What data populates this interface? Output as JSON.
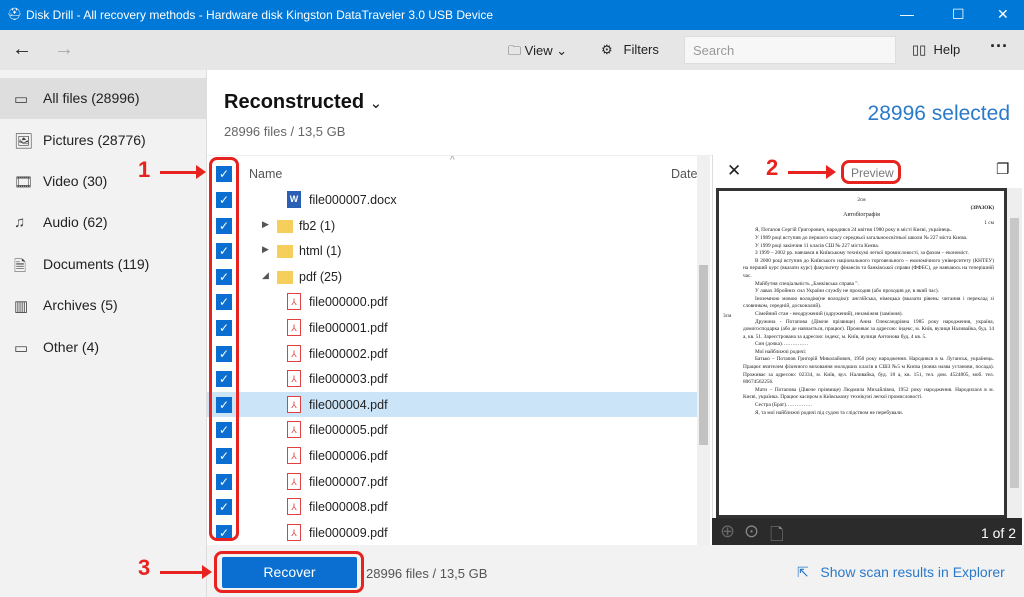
{
  "window": {
    "title": "Disk Drill - All recovery methods - Hardware disk Kingston DataTraveler 3.0 USB Device"
  },
  "toolbar": {
    "view": "View",
    "filters": "Filters",
    "search_placeholder": "Search",
    "help": "Help"
  },
  "sidebar": {
    "items": [
      {
        "label": "All files (28996)",
        "icon": "all-files-icon",
        "selected": true
      },
      {
        "label": "Pictures (28776)",
        "icon": "picture-icon"
      },
      {
        "label": "Video (30)",
        "icon": "video-icon"
      },
      {
        "label": "Audio (62)",
        "icon": "audio-icon"
      },
      {
        "label": "Documents (119)",
        "icon": "document-icon"
      },
      {
        "label": "Archives (5)",
        "icon": "archive-icon"
      },
      {
        "label": "Other (4)",
        "icon": "other-icon"
      }
    ]
  },
  "main": {
    "title": "Reconstructed",
    "subtitle": "28996 files / 13,5 GB",
    "selected": "28996 selected",
    "columns": {
      "name": "Name",
      "date": "Date"
    },
    "rows": [
      {
        "name": "file000007.docx",
        "type": "docx",
        "level": 2
      },
      {
        "name": "fb2 (1)",
        "type": "folder",
        "expanded": false,
        "level": 1
      },
      {
        "name": "html (1)",
        "type": "folder",
        "expanded": false,
        "level": 1
      },
      {
        "name": "pdf (25)",
        "type": "folder",
        "expanded": true,
        "level": 1
      },
      {
        "name": "file000000.pdf",
        "type": "pdf",
        "level": 2
      },
      {
        "name": "file000001.pdf",
        "type": "pdf",
        "level": 2
      },
      {
        "name": "file000002.pdf",
        "type": "pdf",
        "level": 2
      },
      {
        "name": "file000003.pdf",
        "type": "pdf",
        "level": 2
      },
      {
        "name": "file000004.pdf",
        "type": "pdf",
        "level": 2,
        "selected": true
      },
      {
        "name": "file000005.pdf",
        "type": "pdf",
        "level": 2
      },
      {
        "name": "file000006.pdf",
        "type": "pdf",
        "level": 2
      },
      {
        "name": "file000007.pdf",
        "type": "pdf",
        "level": 2
      },
      {
        "name": "file000008.pdf",
        "type": "pdf",
        "level": 2
      },
      {
        "name": "file000009.pdf",
        "type": "pdf",
        "level": 2
      }
    ]
  },
  "preview": {
    "label": "Preview",
    "page": "1 of 2",
    "doc": {
      "stamp": "(ЗРАЗОК)",
      "heading": "Автобіографія",
      "margin_left": "3см",
      "margin_top": "2см",
      "margin_right": "1 см",
      "lines": [
        "Я, Потапов Сергій Григорович, народився 24 квітня 1980 року в місті Києві, українець.",
        "У 1989 році вступив до першого класу середньої загальноосвітньої школи № 227 міста Києва.",
        "У 1999 році закінчив 11 класів СШ № 227 міста Києва.",
        "З 1999 – 2002 рр. навчався в Київському технікумі легкої промисловості, за фахом – економіст.",
        "В 2000 році вступив до Київського національного торговельного – економічного університету (КНТЕУ) на перший курс (вказати курс) факультету фінансів та банківської справи (ФФБС), де навчаюсь на теперішній час.",
        "Майбутня спеціальність „Банківська справа ”.",
        "У лавах Збройних сил України службу не проходив (або проходив де, в який час).",
        "Іноземною мовою володію(не володію): англійська, німецька (вказати рівень: читання і переклад зі словником, середній, досконалий).",
        "Сімейний стан - неодружений (одружений), незаміжня (заміжня).",
        "Дружина - Потапова (Дівоче прізвище) Анна Олександрівна 1985 року народження, україна, домогосподарка (або де навчається, працює). Проживає за адресою: індекс, м. Київ, вулиця Наливайка, буд. 14 а, кв. 51. Зареєстрована за адресою: індекс, м. Київ, вулиця Антонова буд. 4 кв. 5.",
        "Син (дочка)……………",
        "Мої найближчі родичі:",
        "Батько – Потапов Григорій Миколайович, 1950 року народження. Народився в м. Луганськ, українець. Працює вчителем фізичного виховання молодших класів в СШЗ №5 м Києва (повна назва установи, посада). Проживає за адресою: 02334, м. Київ, вул. Наливайка, буд. 18 а, кв. 151, тел. дом. 4524805, моб. тел. 80674562256.",
        "Мати – Потапова (Дівоче прізвище) Людмила Михайлівна, 1952 року народження. Народилася в м. Києві, українка. Працює касиром в Київському технікумі легкої промисловості.",
        "Сестра (Брат)……………",
        "Я, та мої найближчі родичі під судом та слідством не перебували."
      ]
    }
  },
  "bottom": {
    "recover": "Recover",
    "summary": "28996 files / 13,5 GB",
    "explorer": "Show scan results in Explorer"
  },
  "annotations": {
    "one": "1",
    "two": "2",
    "three": "3"
  },
  "colors": {
    "titlebar": "#0078d7",
    "accent": "#0a6fd1",
    "annotation": "#e8221e",
    "selected_row": "#cce4f7"
  }
}
